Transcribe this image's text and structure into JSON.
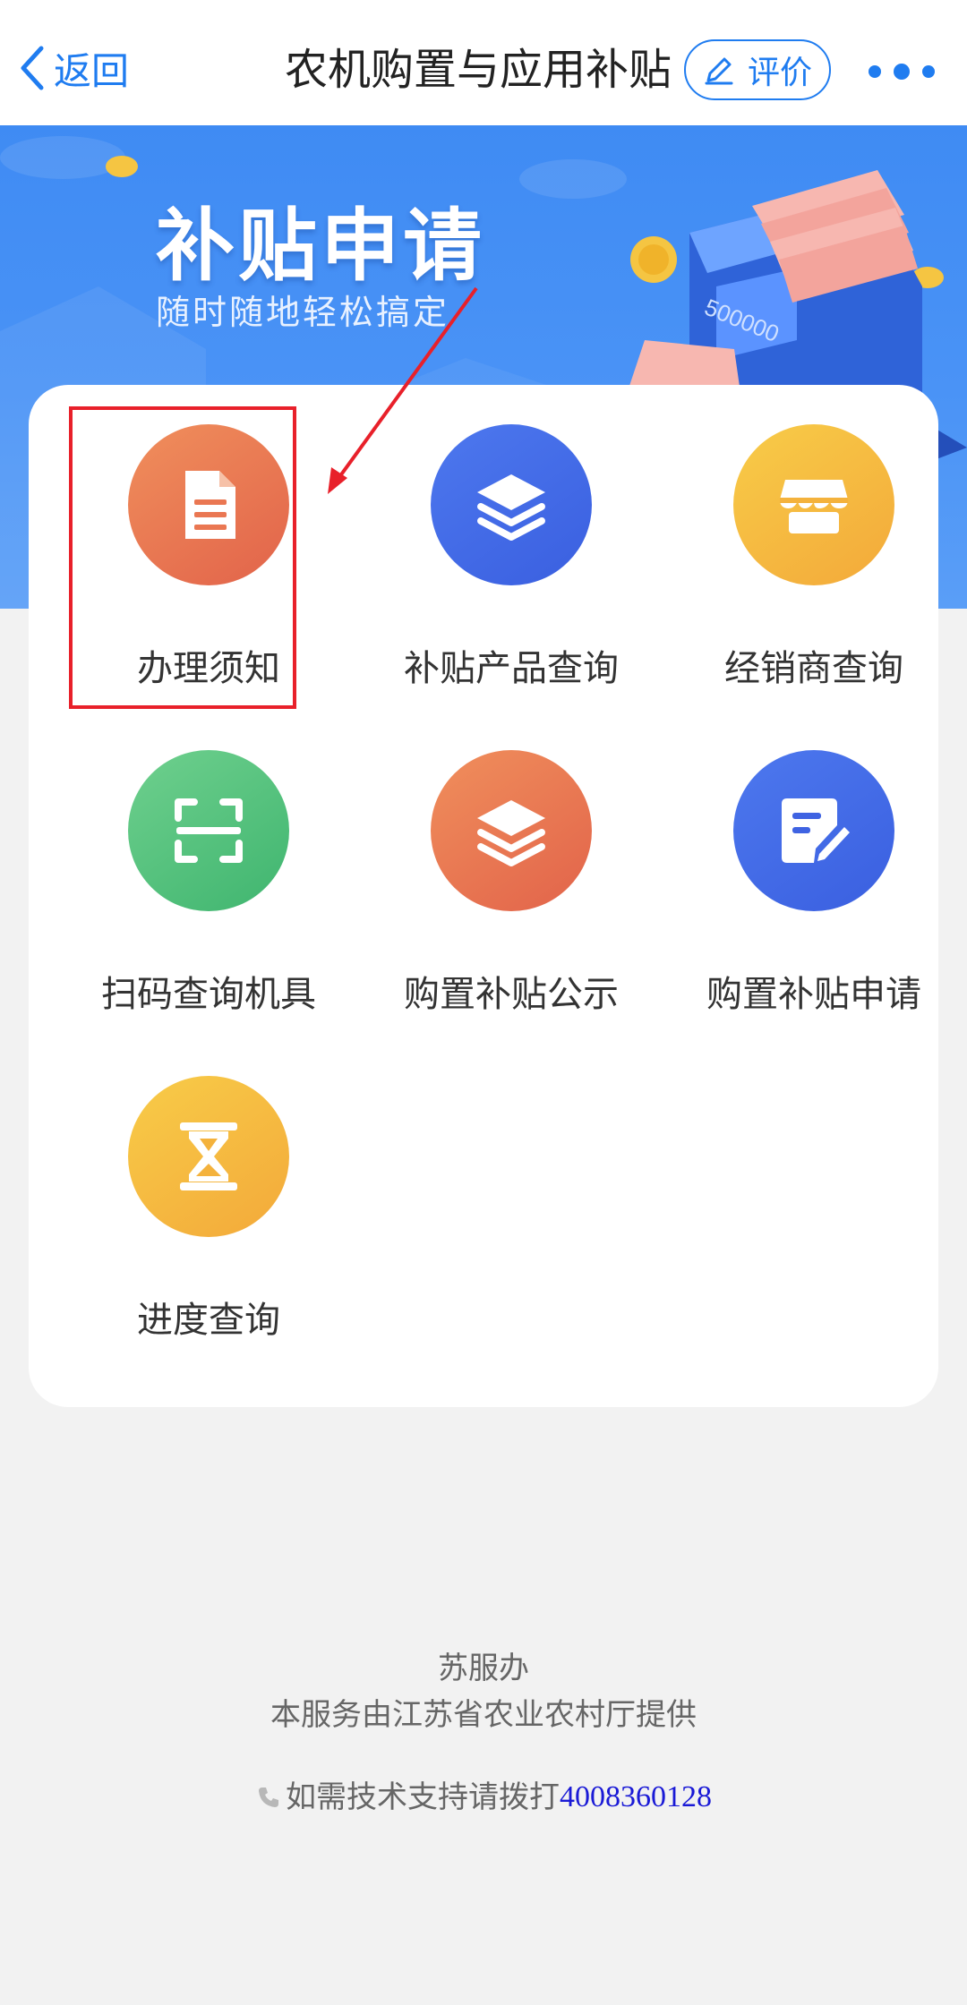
{
  "nav": {
    "back_label": "返回",
    "title": "农机购置与应用补贴",
    "rate_label": "评价"
  },
  "banner": {
    "title": "补贴申请",
    "subtitle": "随时随地轻松搞定",
    "machine_number": "500000"
  },
  "services": [
    {
      "label": "办理须知",
      "icon": "document-icon",
      "color": "orange"
    },
    {
      "label": "补贴产品查询",
      "icon": "layers-icon",
      "color": "blue"
    },
    {
      "label": "经销商查询",
      "icon": "store-icon",
      "color": "yellow"
    },
    {
      "label": "扫码查询机具",
      "icon": "scan-icon",
      "color": "green"
    },
    {
      "label": "购置补贴公示",
      "icon": "layers-icon",
      "color": "orange"
    },
    {
      "label": "购置补贴申请",
      "icon": "edit-form-icon",
      "color": "blue"
    },
    {
      "label": "进度查询",
      "icon": "hourglass-icon",
      "color": "yellow"
    }
  ],
  "footer": {
    "brand": "苏服办",
    "provider": "本服务由江苏省农业农村厅提供",
    "support_text": "如需技术支持请拨打",
    "phone": "4008360128"
  },
  "colors": {
    "accent": "#1f7cf0",
    "highlight": "#e8202a",
    "phone_link": "#1a1ad6"
  }
}
